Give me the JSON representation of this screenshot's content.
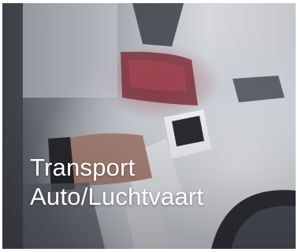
{
  "tile": {
    "title_line1": "Transport",
    "title_line2": "Auto/Luchtvaart",
    "image_description_icon": "ev-charging-photo"
  },
  "colors": {
    "text": "#ffffff",
    "tail_light": "#8c2837",
    "car_body": "#d6d8dc",
    "charger": "#e9eaec",
    "glove": "#2b2d33"
  }
}
